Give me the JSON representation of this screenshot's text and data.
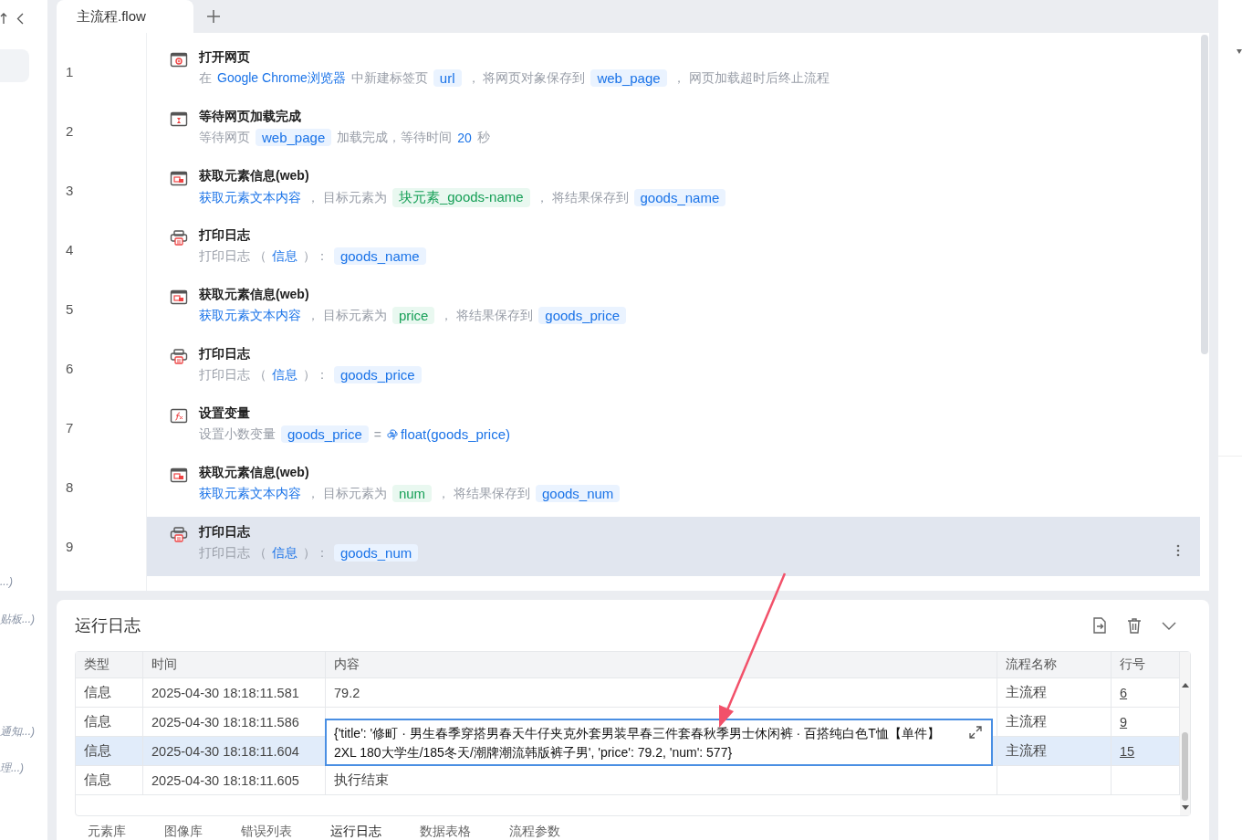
{
  "sidebar": {
    "items": [
      {
        "label": "...)"
      },
      {
        "label": "贴板...)"
      },
      {
        "label": "通知...)"
      },
      {
        "label": "理...)"
      }
    ]
  },
  "editor": {
    "tabs": [
      {
        "label": "主流程.flow",
        "selected": true
      }
    ],
    "steps": [
      {
        "number": "1",
        "kind": "open_page",
        "title": "打开网页",
        "selected": false,
        "parts": [
          {
            "kind": "text",
            "text": "在"
          },
          {
            "kind": "link",
            "text": "Google Chrome浏览器"
          },
          {
            "kind": "text",
            "text": "中新建标签页"
          },
          {
            "kind": "var",
            "text": "url"
          },
          {
            "kind": "text",
            "text": "， 将网页对象保存到"
          },
          {
            "kind": "var",
            "text": "web_page"
          },
          {
            "kind": "text",
            "text": "， 网页加载超时后终止流程"
          }
        ]
      },
      {
        "number": "2",
        "kind": "wait",
        "title": "等待网页加载完成",
        "selected": false,
        "parts": [
          {
            "kind": "text",
            "text": "等待网页"
          },
          {
            "kind": "var",
            "text": "web_page"
          },
          {
            "kind": "text",
            "text": "加载完成，等待时间"
          },
          {
            "kind": "link",
            "text": "20"
          },
          {
            "kind": "text",
            "text": "秒"
          }
        ]
      },
      {
        "number": "3",
        "kind": "get_element",
        "title": "获取元素信息(web)",
        "selected": false,
        "parts": [
          {
            "kind": "link",
            "text": "获取元素文本内容"
          },
          {
            "kind": "text",
            "text": "， 目标元素为"
          },
          {
            "kind": "element",
            "text": "块元素_goods-name"
          },
          {
            "kind": "text",
            "text": "， 将结果保存到"
          },
          {
            "kind": "var",
            "text": "goods_name"
          }
        ]
      },
      {
        "number": "4",
        "kind": "print",
        "title": "打印日志",
        "selected": false,
        "parts": [
          {
            "kind": "text",
            "text": "打印日志 （"
          },
          {
            "kind": "link",
            "text": "信息"
          },
          {
            "kind": "text",
            "text": "）："
          },
          {
            "kind": "var",
            "text": "goods_name"
          }
        ]
      },
      {
        "number": "5",
        "kind": "get_element",
        "title": "获取元素信息(web)",
        "selected": false,
        "parts": [
          {
            "kind": "link",
            "text": "获取元素文本内容"
          },
          {
            "kind": "text",
            "text": "， 目标元素为"
          },
          {
            "kind": "element",
            "text": "price"
          },
          {
            "kind": "text",
            "text": "， 将结果保存到"
          },
          {
            "kind": "var",
            "text": "goods_price"
          }
        ]
      },
      {
        "number": "6",
        "kind": "print",
        "title": "打印日志",
        "selected": false,
        "parts": [
          {
            "kind": "text",
            "text": "打印日志 （"
          },
          {
            "kind": "link",
            "text": "信息"
          },
          {
            "kind": "text",
            "text": "）："
          },
          {
            "kind": "var",
            "text": "goods_price"
          }
        ]
      },
      {
        "number": "7",
        "kind": "set_var",
        "title": "设置变量",
        "selected": false,
        "parts": [
          {
            "kind": "text",
            "text": "设置小数变量"
          },
          {
            "kind": "var",
            "text": "goods_price"
          },
          {
            "kind": "text",
            "text": "="
          },
          {
            "kind": "python",
            "text": "float(goods_price)"
          }
        ]
      },
      {
        "number": "8",
        "kind": "get_element",
        "title": "获取元素信息(web)",
        "selected": false,
        "parts": [
          {
            "kind": "link",
            "text": "获取元素文本内容"
          },
          {
            "kind": "text",
            "text": "， 目标元素为"
          },
          {
            "kind": "element",
            "text": "num"
          },
          {
            "kind": "text",
            "text": "， 将结果保存到"
          },
          {
            "kind": "var",
            "text": "goods_num"
          }
        ]
      },
      {
        "number": "9",
        "kind": "print",
        "title": "打印日志",
        "selected": true,
        "parts": [
          {
            "kind": "text",
            "text": "打印日志 （"
          },
          {
            "kind": "link",
            "text": "信息"
          },
          {
            "kind": "text",
            "text": "）："
          },
          {
            "kind": "var",
            "text": "goods_num"
          }
        ]
      }
    ]
  },
  "log": {
    "title": "运行日志",
    "columns": [
      "类型",
      "时间",
      "内容",
      "流程名称",
      "行号"
    ],
    "rows": [
      {
        "type": "信息",
        "time": "2025-04-30 18:18:11.581",
        "content": "79.2",
        "flow": "主流程",
        "line": "6",
        "selected": false
      },
      {
        "type": "信息",
        "time": "2025-04-30 18:18:11.586",
        "flow": "主流程",
        "line": "9",
        "selected": false
      },
      {
        "type": "信息",
        "time": "2025-04-30 18:18:11.604",
        "flow": "主流程",
        "line": "15",
        "selected": true
      },
      {
        "type": "信息",
        "time": "2025-04-30 18:18:11.605",
        "content": "执行结束",
        "selected": false
      }
    ],
    "popup": {
      "text": "{'title': '修町 · 男生春季穿搭男春天牛仔夹克外套男装早春三件套春秋季男士休闲裤 · 百搭纯白色T恤【单件】 2XL 180大学生/185冬天/潮牌潮流韩版裤子男', 'price': 79.2, 'num': 577}"
    },
    "bottom_tabs": [
      {
        "label": "元素库",
        "selected": false
      },
      {
        "label": "图像库",
        "selected": false
      },
      {
        "label": "错误列表",
        "selected": false
      },
      {
        "label": "运行日志",
        "selected": true
      },
      {
        "label": "数据表格",
        "selected": false
      },
      {
        "label": "流程参数",
        "selected": false
      }
    ]
  }
}
